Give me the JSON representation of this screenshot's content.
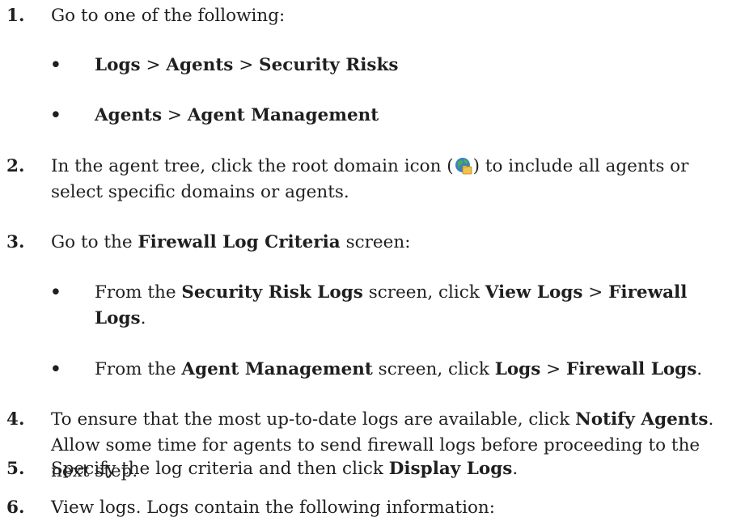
{
  "steps": [
    {
      "number": "1.",
      "text": "Go to one of the following:",
      "bullets": [
        {
          "parts": [
            [
              "b",
              "Logs"
            ],
            [
              "t",
              " > "
            ],
            [
              "b",
              "Agents"
            ],
            [
              "t",
              " > "
            ],
            [
              "b",
              "Security Risks"
            ]
          ]
        },
        {
          "parts": [
            [
              "b",
              "Agents"
            ],
            [
              "t",
              " > "
            ],
            [
              "b",
              "Agent Management"
            ]
          ]
        }
      ]
    },
    {
      "number": "2.",
      "text_before_icon": "In the agent tree, click the root domain icon (",
      "icon": "root-domain-globe-icon",
      "text_after_icon": ") to include all agents or select specific domains or agents."
    },
    {
      "number": "3.",
      "parts": [
        [
          "t",
          "Go to the "
        ],
        [
          "b",
          "Firewall Log Criteria"
        ],
        [
          "t",
          " screen:"
        ]
      ],
      "bullets": [
        {
          "parts": [
            [
              "t",
              "From the "
            ],
            [
              "b",
              "Security Risk Logs"
            ],
            [
              "t",
              " screen, click "
            ],
            [
              "b",
              "View Logs"
            ],
            [
              "t",
              " > "
            ],
            [
              "b",
              "Firewall Logs"
            ],
            [
              "t",
              "."
            ]
          ]
        },
        {
          "parts": [
            [
              "t",
              "From the "
            ],
            [
              "b",
              "Agent Management"
            ],
            [
              "t",
              " screen, click "
            ],
            [
              "b",
              "Logs"
            ],
            [
              "t",
              " > "
            ],
            [
              "b",
              "Firewall Logs"
            ],
            [
              "t",
              "."
            ]
          ]
        }
      ]
    },
    {
      "number": "4.",
      "parts": [
        [
          "t",
          "To ensure that the most up-to-date logs are available, click "
        ],
        [
          "b",
          "Notify Agents"
        ],
        [
          "t",
          ". Allow some time for agents to send firewall logs before proceeding to the next step."
        ]
      ]
    },
    {
      "number": "5.",
      "parts": [
        [
          "t",
          "Specify the log criteria and then click "
        ],
        [
          "b",
          "Display Logs"
        ],
        [
          "t",
          "."
        ]
      ]
    },
    {
      "number": "6.",
      "text": "View logs. Logs contain the following information:"
    }
  ],
  "bullet_char": "•",
  "colors": {
    "text": "#1f1f1f",
    "globe_blue": "#3b82c4",
    "globe_green": "#4caf50",
    "folder": "#f2c14e"
  }
}
